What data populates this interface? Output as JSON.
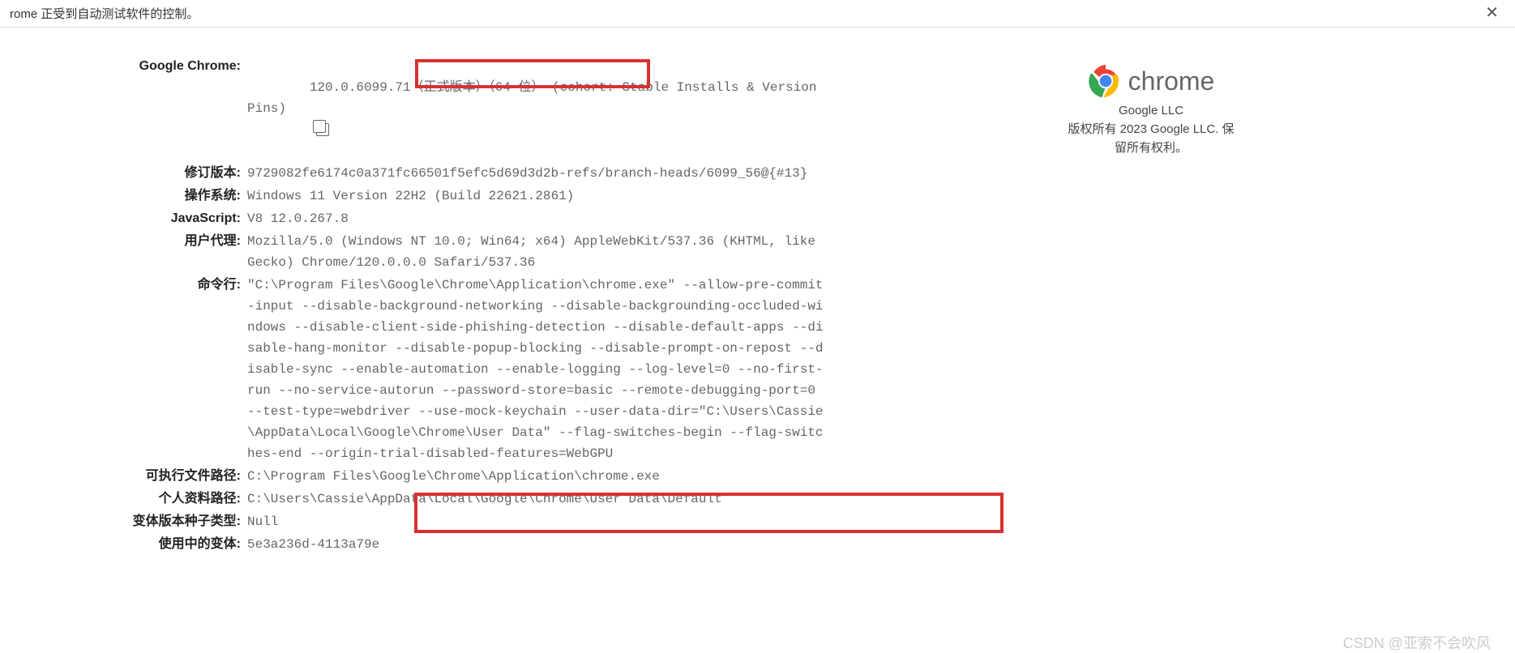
{
  "topbar": {
    "message": "rome 正受到自动测试软件的控制。",
    "close": "✕"
  },
  "rows": {
    "chrome": {
      "label": "Google Chrome:",
      "value": "120.0.6099.71（正式版本）（64 位） (cohort: Stable Installs & Version Pins)"
    },
    "revision": {
      "label": "修订版本:",
      "value": "9729082fe6174c0a371fc66501f5efc5d69d3d2b-refs/branch-heads/6099_56@{#13}"
    },
    "os": {
      "label": "操作系统:",
      "value": "Windows 11 Version 22H2 (Build 22621.2861)"
    },
    "js": {
      "label": "JavaScript:",
      "value": "V8 12.0.267.8"
    },
    "ua": {
      "label": "用户代理:",
      "value": "Mozilla/5.0 (Windows NT 10.0; Win64; x64) AppleWebKit/537.36 (KHTML, like Gecko) Chrome/120.0.0.0 Safari/537.36"
    },
    "cmd": {
      "label": "命令行:",
      "value": "\"C:\\Program Files\\Google\\Chrome\\Application\\chrome.exe\" --allow-pre-commit-input --disable-background-networking --disable-backgrounding-occluded-windows --disable-client-side-phishing-detection --disable-default-apps --disable-hang-monitor --disable-popup-blocking --disable-prompt-on-repost --disable-sync --enable-automation --enable-logging --log-level=0 --no-first-run --no-service-autorun --password-store=basic --remote-debugging-port=0 --test-type=webdriver --use-mock-keychain --user-data-dir=\"C:\\Users\\Cassie\\AppData\\Local\\Google\\Chrome\\User Data\" --flag-switches-begin --flag-switches-end --origin-trial-disabled-features=WebGPU"
    },
    "exe": {
      "label": "可执行文件路径:",
      "value": "C:\\Program Files\\Google\\Chrome\\Application\\chrome.exe"
    },
    "profile": {
      "label": "个人资料路径:",
      "value": "C:\\Users\\Cassie\\AppData\\Local\\Google\\Chrome\\User Data\\Default"
    },
    "seed": {
      "label": "变体版本种子类型:",
      "value": "Null"
    },
    "variation": {
      "label": "使用中的变体:",
      "value": "5e3a236d-4113a79e"
    }
  },
  "logo": {
    "text": "chrome",
    "company": "Google LLC",
    "copyright": "版权所有 2023 Google LLC. 保留所有权利。"
  },
  "watermark": "CSDN @亚索不会吹风"
}
